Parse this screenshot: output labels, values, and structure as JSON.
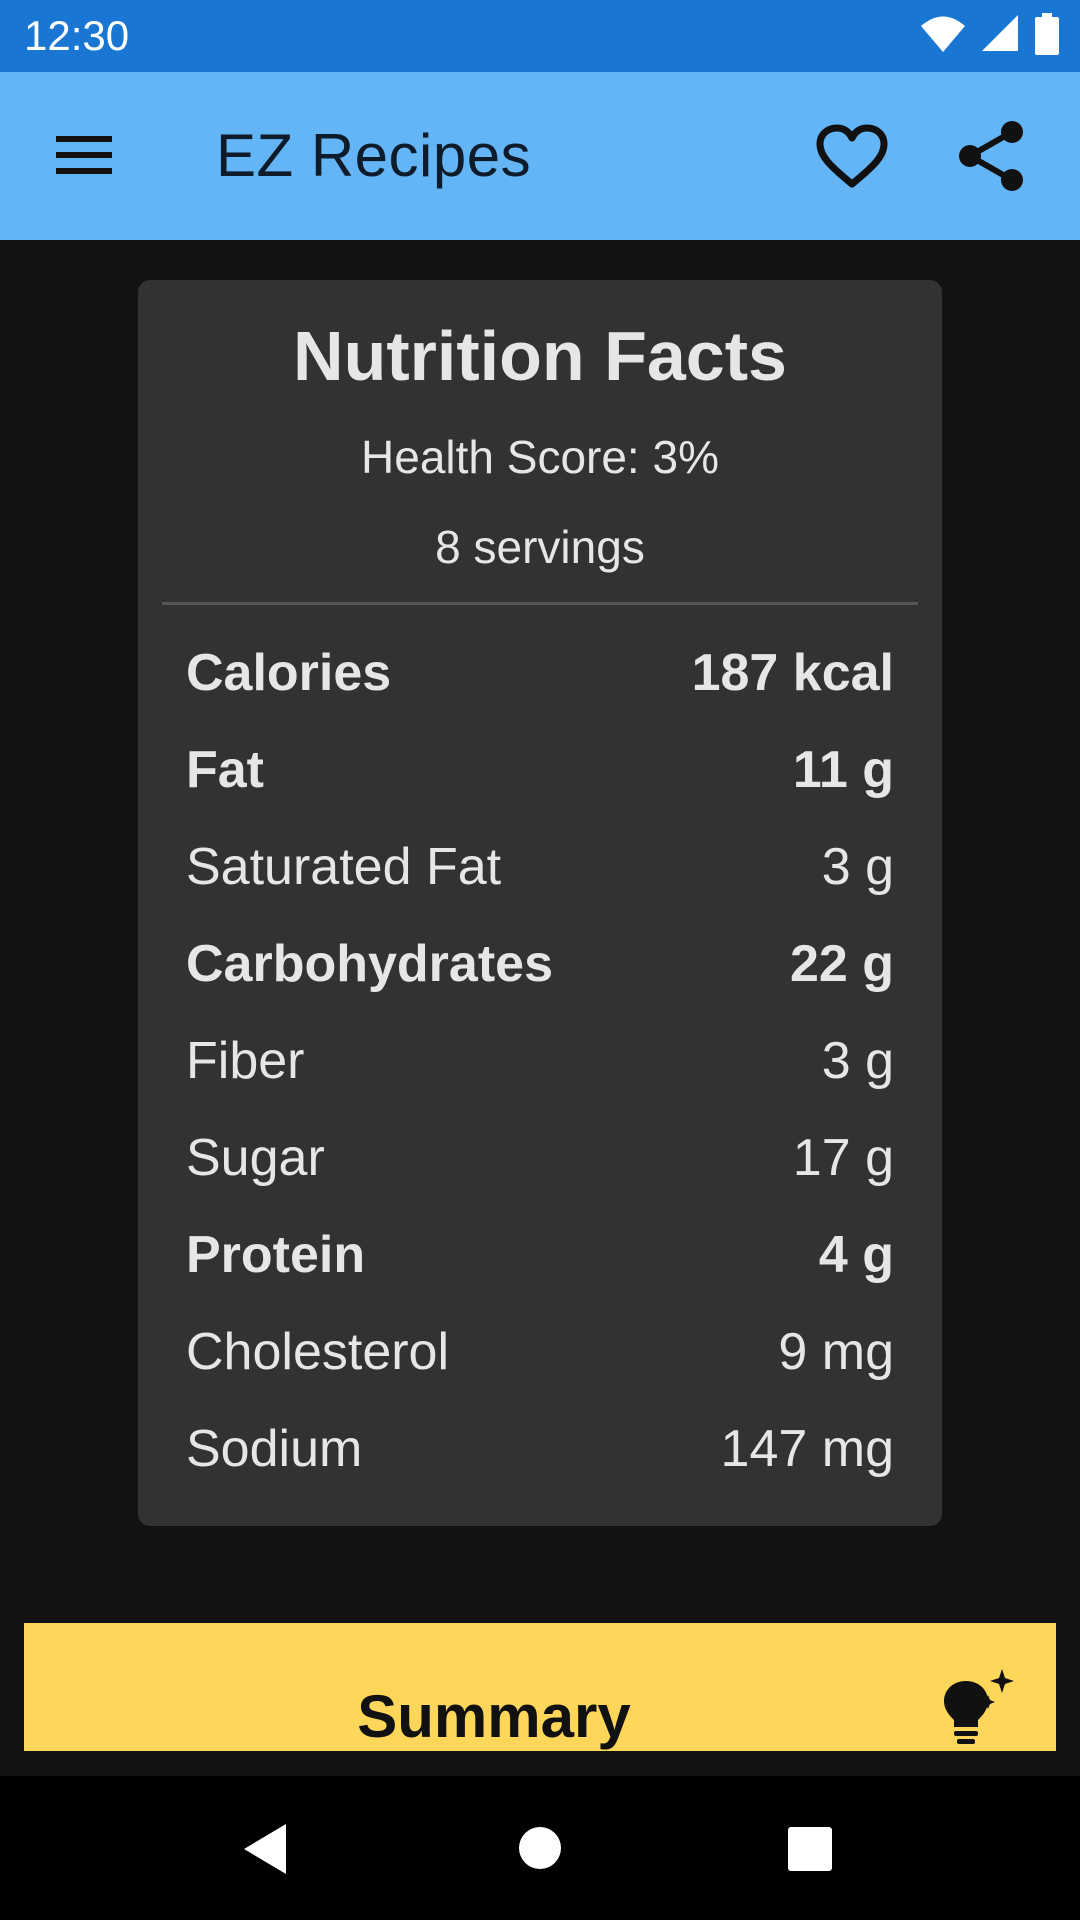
{
  "status_bar": {
    "time": "12:30",
    "icons": [
      "wifi-icon",
      "cell-signal-icon",
      "battery-icon"
    ]
  },
  "app_bar": {
    "title": "EZ Recipes",
    "icons": [
      "menu-icon",
      "heart-outline-icon",
      "share-icon"
    ]
  },
  "nutrition": {
    "title": "Nutrition Facts",
    "health_score": "Health Score: 3%",
    "servings": "8 servings",
    "facts": [
      {
        "label": "Calories",
        "value": "187 kcal",
        "bold": true
      },
      {
        "label": "Fat",
        "value": "11 g",
        "bold": true
      },
      {
        "label": "Saturated Fat",
        "value": "3 g",
        "bold": false
      },
      {
        "label": "Carbohydrates",
        "value": "22 g",
        "bold": true
      },
      {
        "label": "Fiber",
        "value": "3 g",
        "bold": false
      },
      {
        "label": "Sugar",
        "value": "17 g",
        "bold": false
      },
      {
        "label": "Protein",
        "value": "4 g",
        "bold": true
      },
      {
        "label": "Cholesterol",
        "value": "9 mg",
        "bold": false
      },
      {
        "label": "Sodium",
        "value": "147 mg",
        "bold": false
      }
    ]
  },
  "summary": {
    "label": "Summary",
    "icon": "lightbulb-sparkle-icon"
  },
  "colors": {
    "status_bar": "#1976D2",
    "app_bar": "#64B5F6",
    "background": "#121212",
    "card": "#323232",
    "summary_bar": "#FDD65A"
  }
}
